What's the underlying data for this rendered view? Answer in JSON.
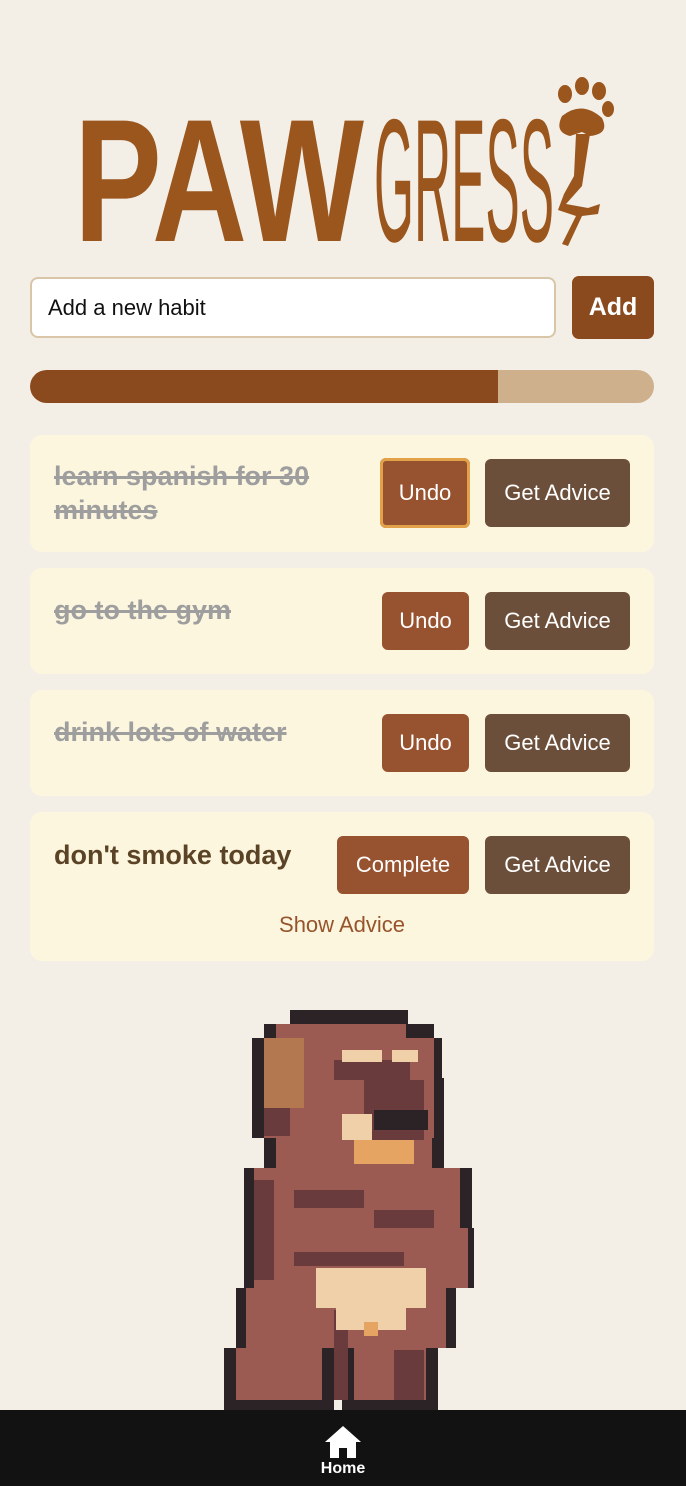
{
  "brand": {
    "logo_primary": "PAW",
    "logo_secondary": "GRESS",
    "colors": {
      "brand": "#8b4a1e",
      "background": "#f3eee6",
      "card": "#fdf6df"
    }
  },
  "add_habit": {
    "placeholder": "Add a new habit",
    "button_label": "Add"
  },
  "progress": {
    "completed_fraction": 0.75
  },
  "habits": [
    {
      "title": "learn spanish for 30 minutes",
      "completed": true,
      "action_label": "Undo",
      "advice_label": "Get Advice"
    },
    {
      "title": "go to the gym",
      "completed": true,
      "action_label": "Undo",
      "advice_label": "Get Advice"
    },
    {
      "title": "drink lots of water",
      "completed": true,
      "action_label": "Undo",
      "advice_label": "Get Advice"
    },
    {
      "title": "don't smoke today",
      "completed": false,
      "action_label": "Complete",
      "advice_label": "Get Advice",
      "show_advice_label": "Show Advice"
    }
  ],
  "mascot": {
    "icon": "pixel-dog-mascot"
  },
  "nav": {
    "home_label": "Home",
    "home_icon": "home-icon"
  }
}
